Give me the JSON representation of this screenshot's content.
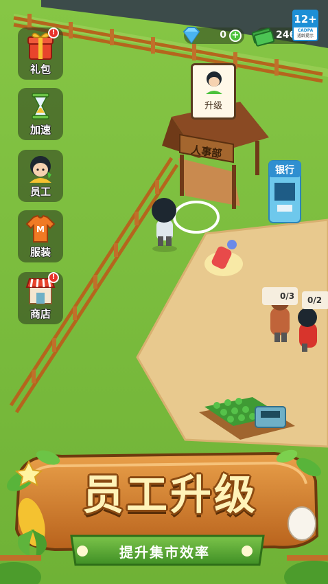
{
  "header": {
    "gem_count": "0",
    "gem_plus": "+",
    "cash_count": "246",
    "age_rating": "12+",
    "age_org": "CADPA",
    "age_tip": "适龄提示"
  },
  "sidebar": {
    "items": [
      {
        "label": "礼包",
        "icon": "gift-box-icon",
        "badge": "!"
      },
      {
        "label": "加速",
        "icon": "hourglass-icon"
      },
      {
        "label": "员工",
        "icon": "staff-avatar-icon"
      },
      {
        "label": "服装",
        "icon": "shirt-icon"
      },
      {
        "label": "商店",
        "icon": "shop-icon",
        "badge": "!"
      }
    ]
  },
  "popup": {
    "label": "升级",
    "icon": "staff-avatar-icon"
  },
  "scene": {
    "hr_sign": "人事部",
    "bank_sign": "银行",
    "counter_1": "0/3",
    "counter_2": "0/2"
  },
  "banner": {
    "title": "员工升级",
    "subtitle": "提升集市效率"
  },
  "colors": {
    "grass": "#7cbd3c",
    "dirt": "#e8c98e",
    "wood": "#8a4a12",
    "accent_green": "#4cc23c",
    "badge_red": "#e8342c",
    "rating_blue": "#1d8fd6"
  }
}
